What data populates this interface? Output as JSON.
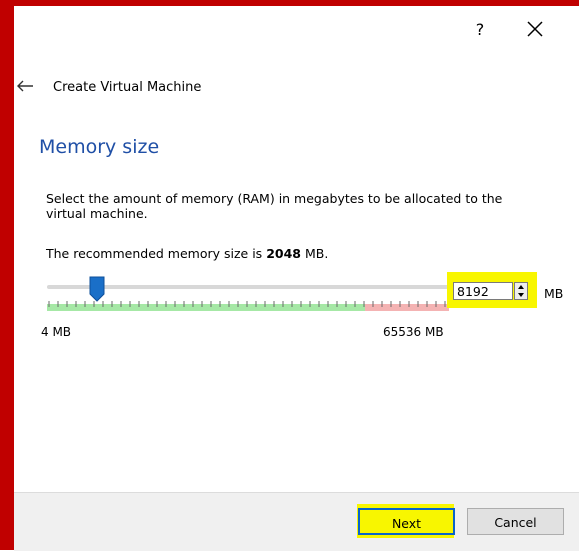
{
  "window": {
    "help_label": "?",
    "close_icon": "close-icon"
  },
  "header": {
    "back_icon": "arrow-left-icon",
    "title": "Create Virtual Machine"
  },
  "main": {
    "section_title": "Memory size",
    "description": "Select the amount of memory (RAM) in megabytes to be allocated to the virtual machine.",
    "recommended_prefix": "The recommended memory size is",
    "recommended_value": "2048",
    "recommended_suffix": "MB.",
    "slider": {
      "min_label": "4 MB",
      "max_label": "65536 MB",
      "value": 8192,
      "min": 4,
      "max": 65536,
      "thumb_color": "#1a6fc8",
      "safe_color": "#a6e8a6",
      "warn_color": "#f4b3b3"
    },
    "memory_input": {
      "value": "8192",
      "unit": "MB"
    }
  },
  "footer": {
    "next_label": "Next",
    "cancel_label": "Cancel"
  },
  "colors": {
    "frame": "#c00000",
    "highlight": "#f8f600",
    "accent": "#1f4fa6",
    "focus_border": "#0a64c8"
  }
}
